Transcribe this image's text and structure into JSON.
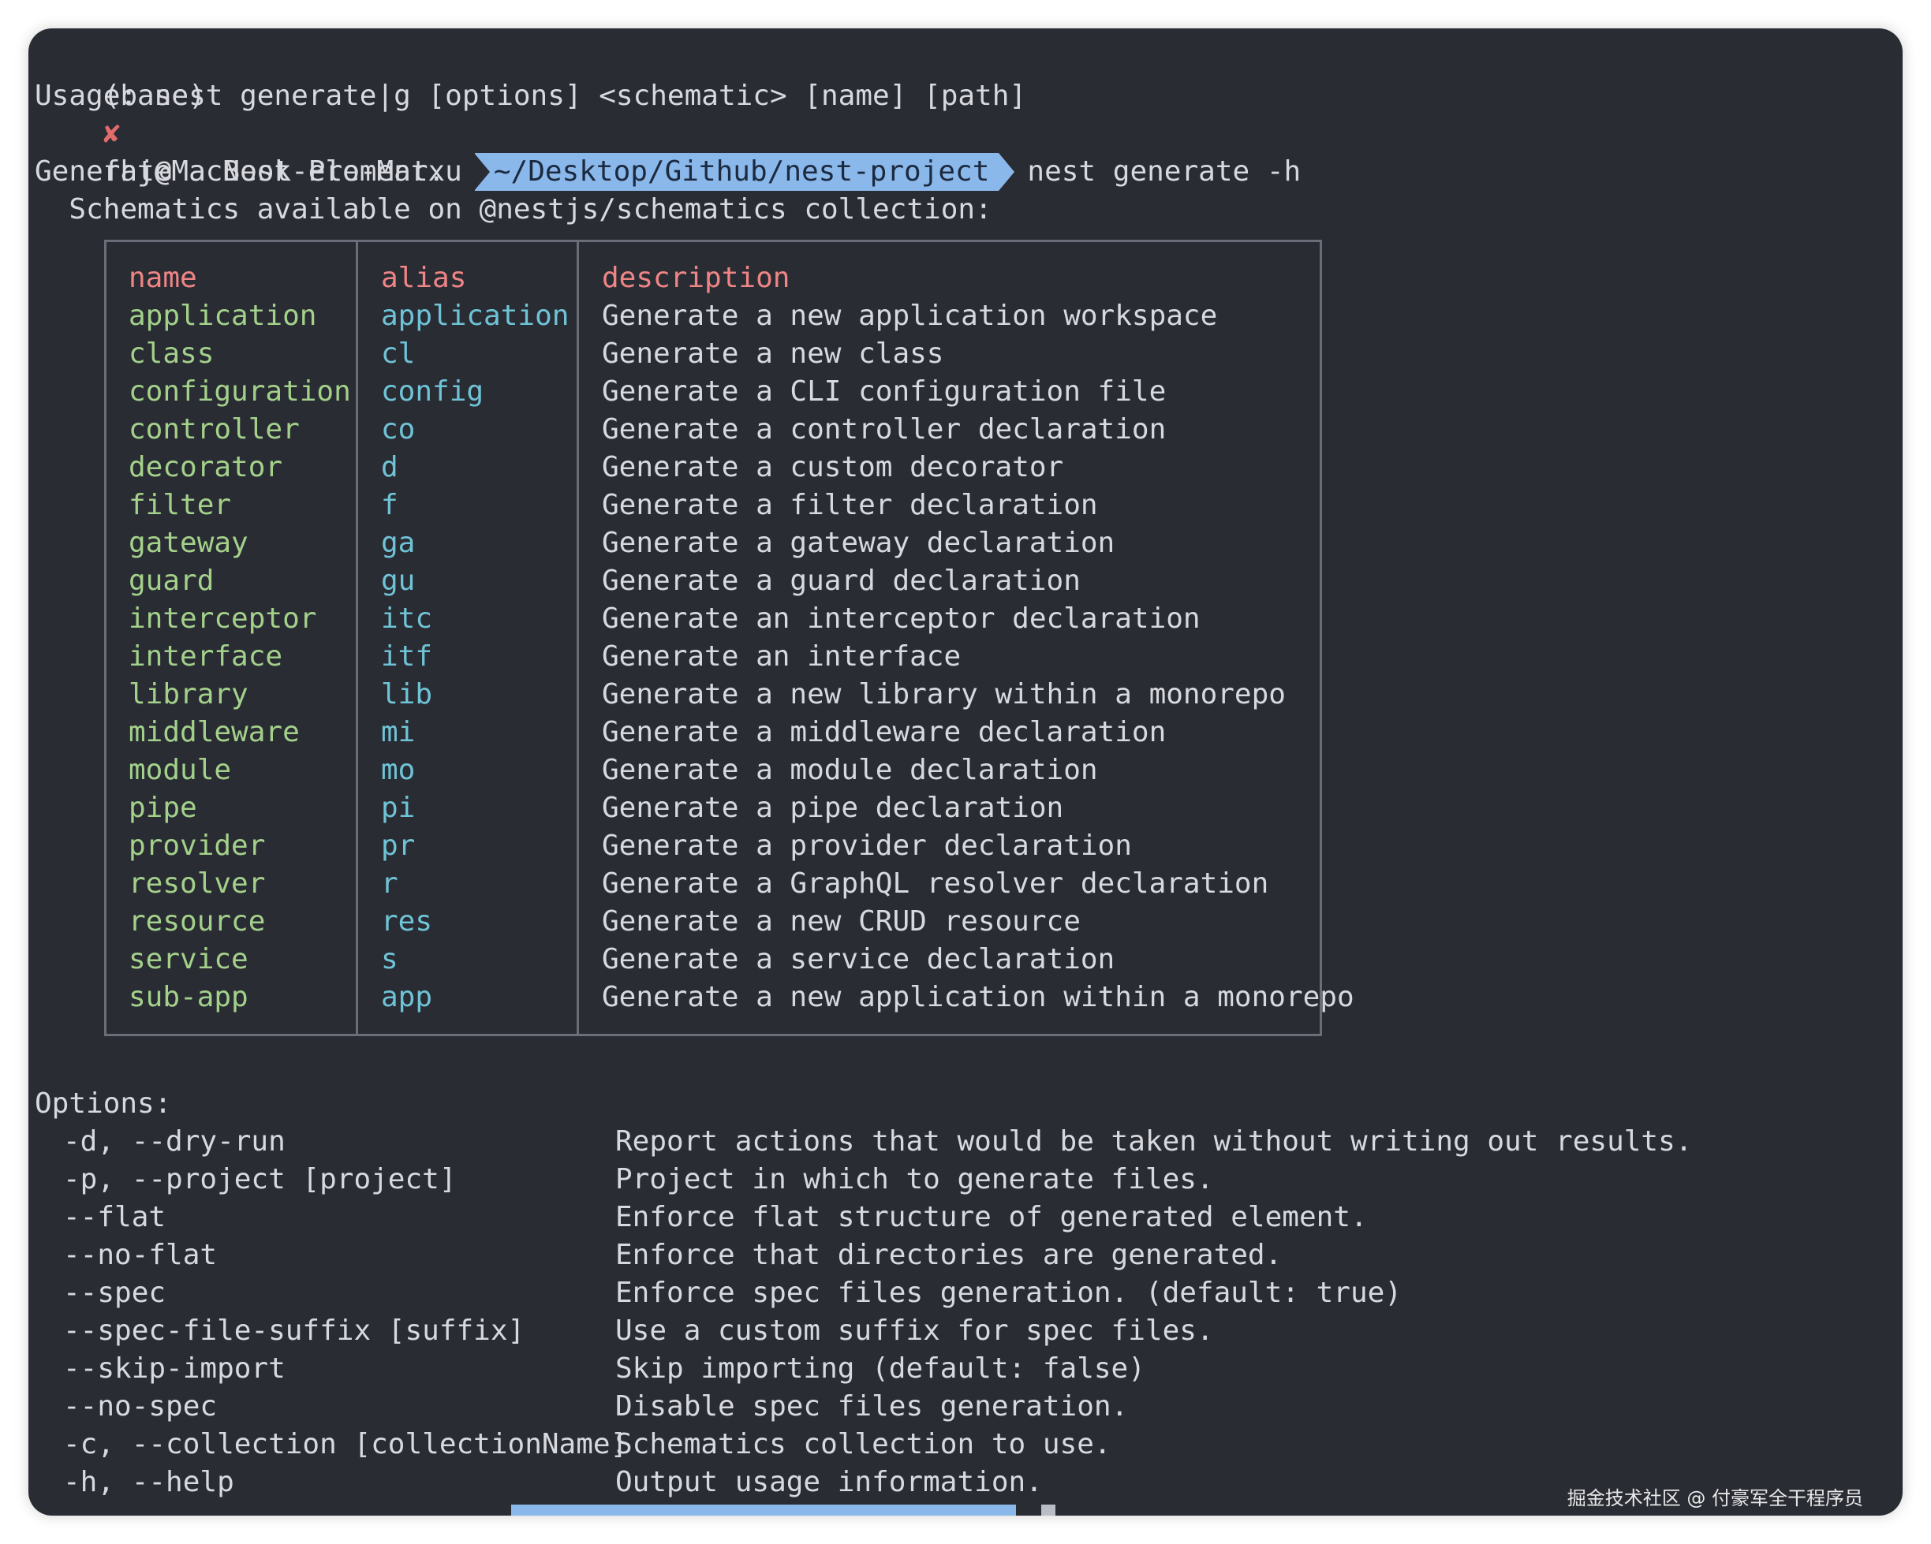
{
  "prompt": {
    "env": "(base)",
    "status_glyph": "✘",
    "host": "fhj@MacBook-Pro-Marxu",
    "cwd": "~/Desktop/Github/nest-project",
    "command": "nest generate -h"
  },
  "usage": "Usage: nest generate|g [options] <schematic> [name] [path]",
  "intro": {
    "line1": "Generate a Nest element.",
    "line2": "  Schematics available on @nestjs/schematics collection:"
  },
  "schematics": {
    "headers": {
      "name": "name",
      "alias": "alias",
      "description": "description"
    },
    "rows": [
      {
        "name": "application",
        "alias": "application",
        "description": "Generate a new application workspace"
      },
      {
        "name": "class",
        "alias": "cl",
        "description": "Generate a new class"
      },
      {
        "name": "configuration",
        "alias": "config",
        "description": "Generate a CLI configuration file"
      },
      {
        "name": "controller",
        "alias": "co",
        "description": "Generate a controller declaration"
      },
      {
        "name": "decorator",
        "alias": "d",
        "description": "Generate a custom decorator"
      },
      {
        "name": "filter",
        "alias": "f",
        "description": "Generate a filter declaration"
      },
      {
        "name": "gateway",
        "alias": "ga",
        "description": "Generate a gateway declaration"
      },
      {
        "name": "guard",
        "alias": "gu",
        "description": "Generate a guard declaration"
      },
      {
        "name": "interceptor",
        "alias": "itc",
        "description": "Generate an interceptor declaration"
      },
      {
        "name": "interface",
        "alias": "itf",
        "description": "Generate an interface"
      },
      {
        "name": "library",
        "alias": "lib",
        "description": "Generate a new library within a monorepo"
      },
      {
        "name": "middleware",
        "alias": "mi",
        "description": "Generate a middleware declaration"
      },
      {
        "name": "module",
        "alias": "mo",
        "description": "Generate a module declaration"
      },
      {
        "name": "pipe",
        "alias": "pi",
        "description": "Generate a pipe declaration"
      },
      {
        "name": "provider",
        "alias": "pr",
        "description": "Generate a provider declaration"
      },
      {
        "name": "resolver",
        "alias": "r",
        "description": "Generate a GraphQL resolver declaration"
      },
      {
        "name": "resource",
        "alias": "res",
        "description": "Generate a new CRUD resource"
      },
      {
        "name": "service",
        "alias": "s",
        "description": "Generate a service declaration"
      },
      {
        "name": "sub-app",
        "alias": "app",
        "description": "Generate a new application within a monorepo"
      }
    ]
  },
  "options": {
    "title": "Options:",
    "items": [
      {
        "flag": "-d, --dry-run",
        "description": "Report actions that would be taken without writing out results."
      },
      {
        "flag": "-p, --project [project]",
        "description": "Project in which to generate files."
      },
      {
        "flag": "--flat",
        "description": "Enforce flat structure of generated element."
      },
      {
        "flag": "--no-flat",
        "description": "Enforce that directories are generated."
      },
      {
        "flag": "--spec",
        "description": "Enforce spec files generation. (default: true)"
      },
      {
        "flag": "--spec-file-suffix [suffix]",
        "description": "Use a custom suffix for spec files."
      },
      {
        "flag": "--skip-import",
        "description": "Skip importing (default: false)"
      },
      {
        "flag": "--no-spec",
        "description": "Disable spec files generation."
      },
      {
        "flag": "-c, --collection [collectionName]",
        "description": "Schematics collection to use."
      },
      {
        "flag": "-h, --help",
        "description": "Output usage information."
      }
    ]
  },
  "watermark": "掘金技术社区 @ 付豪军全干程序员",
  "colors": {
    "background": "#2a2c34",
    "header": "#f08585",
    "name": "#a3d18a",
    "alias": "#6fc3d6",
    "text": "#d7d9de",
    "cwd_segment": "#8bb8ea",
    "error_mark": "#e06c6c"
  }
}
